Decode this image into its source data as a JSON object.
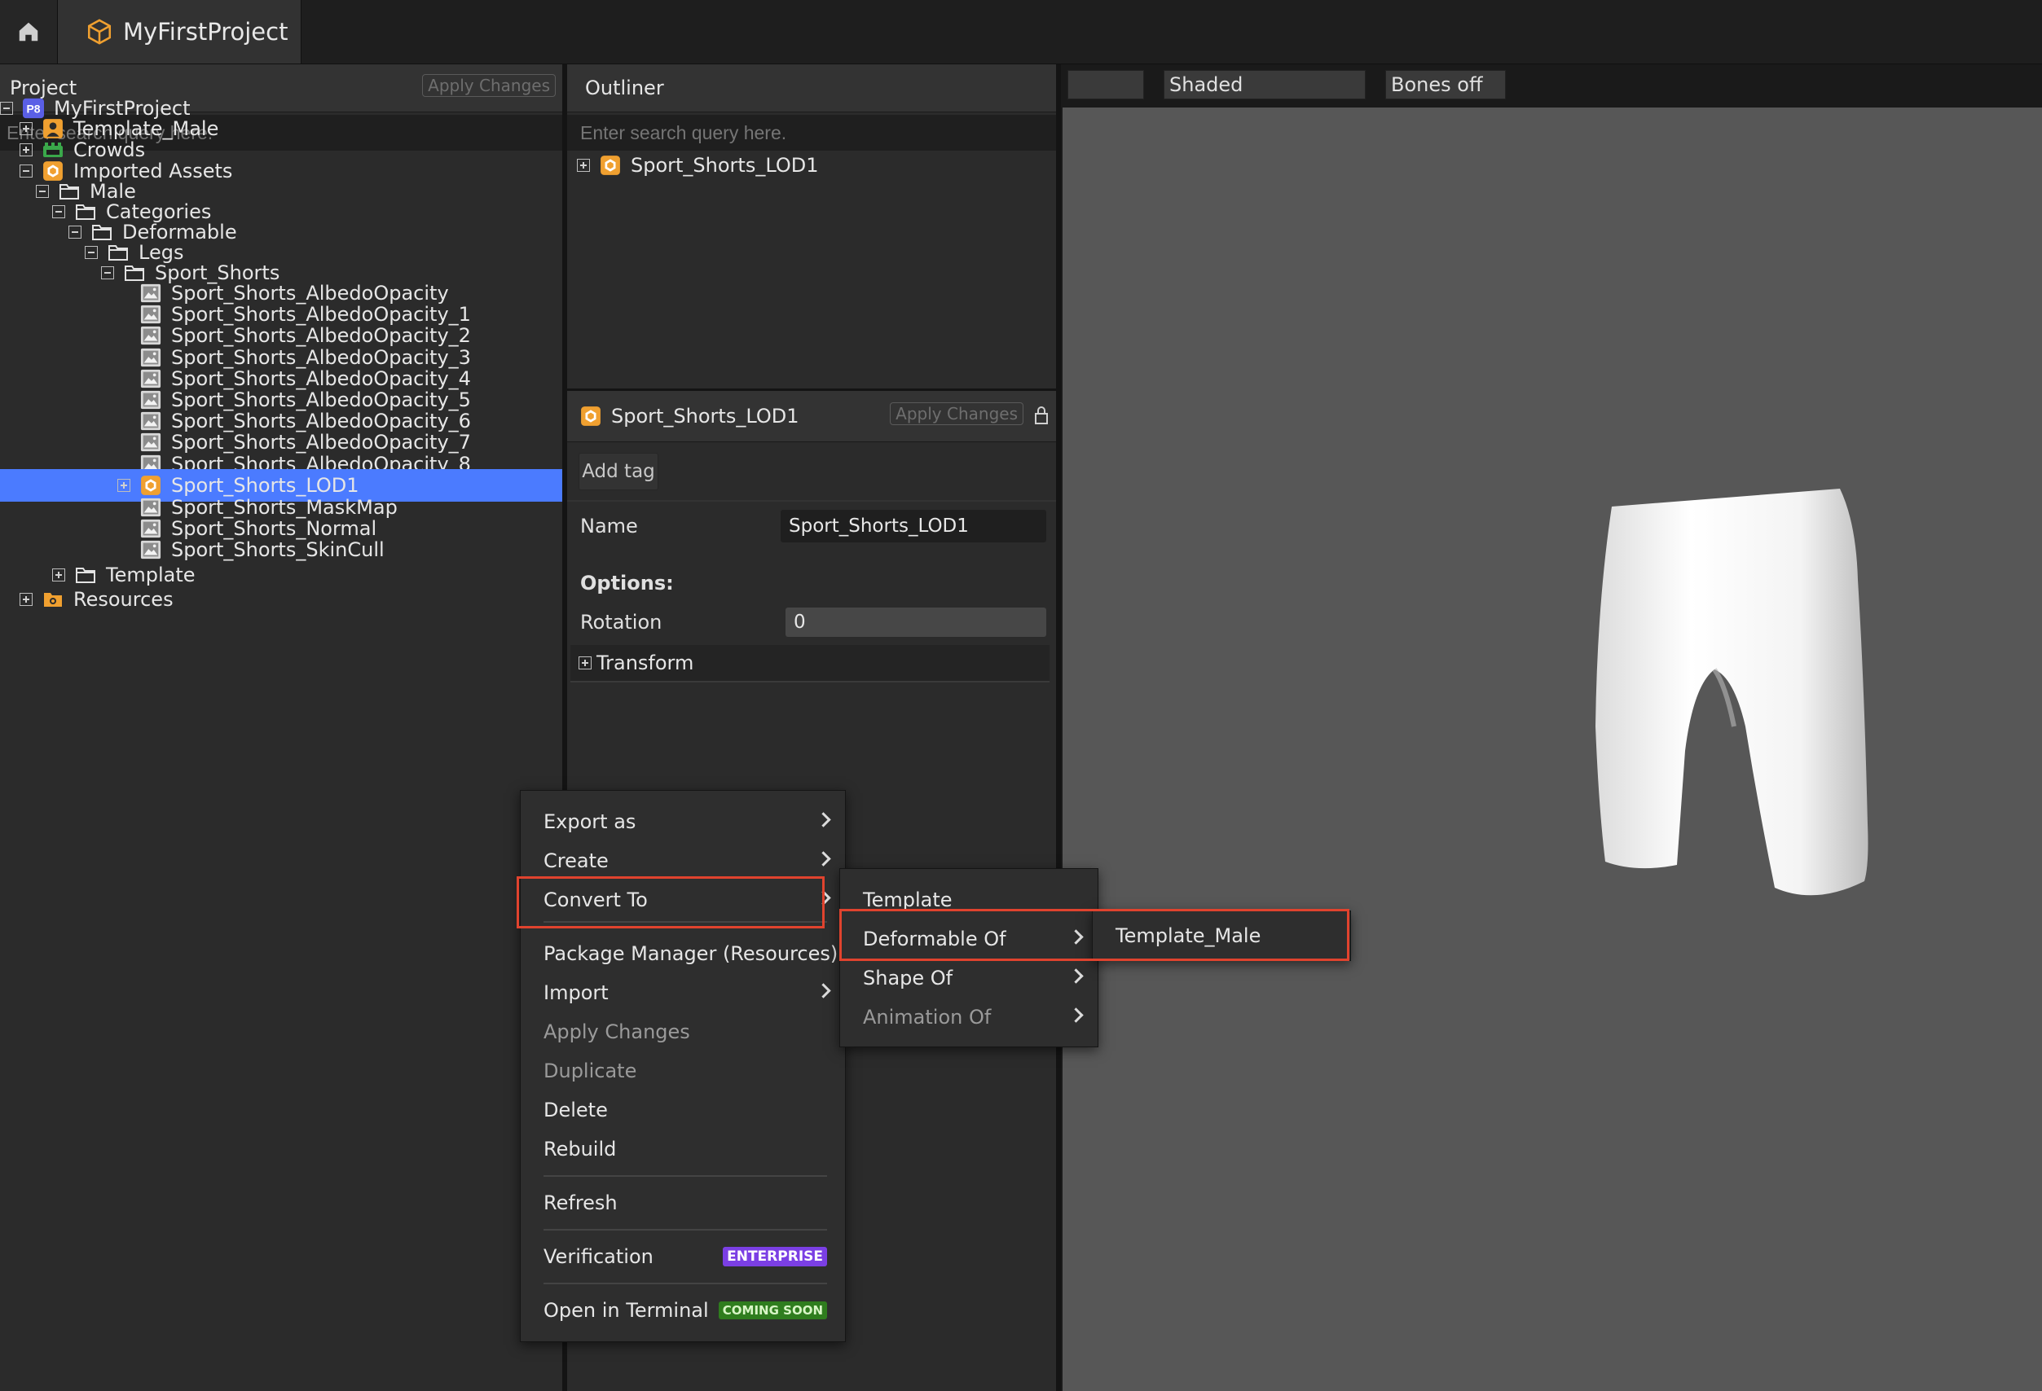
{
  "header": {
    "project_tab": "MyFirstProject"
  },
  "project_panel": {
    "title": "Project",
    "apply_changes": "Apply Changes",
    "search_placeholder": "Enter search query here.",
    "tree": [
      {
        "label": "MyFirstProject",
        "icon": "p8-project-icon",
        "expander": "minus"
      },
      {
        "label": "Template_Male",
        "icon": "template-male-icon",
        "expander": "plus"
      },
      {
        "label": "Crowds",
        "icon": "crowds-icon",
        "expander": "plus"
      },
      {
        "label": "Imported Assets",
        "icon": "imported-assets-icon",
        "expander": "minus"
      },
      {
        "label": "Male",
        "icon": "folder-icon",
        "expander": "minus"
      },
      {
        "label": "Categories",
        "icon": "folder-icon",
        "expander": "minus"
      },
      {
        "label": "Deformable",
        "icon": "folder-icon",
        "expander": "minus"
      },
      {
        "label": "Legs",
        "icon": "folder-icon",
        "expander": "minus"
      },
      {
        "label": "Sport_Shorts",
        "icon": "folder-icon",
        "expander": "minus"
      },
      {
        "label": "Sport_Shorts_AlbedoOpacity",
        "icon": "image-icon",
        "expander": "none"
      },
      {
        "label": "Sport_Shorts_AlbedoOpacity_1",
        "icon": "image-icon",
        "expander": "none"
      },
      {
        "label": "Sport_Shorts_AlbedoOpacity_2",
        "icon": "image-icon",
        "expander": "none"
      },
      {
        "label": "Sport_Shorts_AlbedoOpacity_3",
        "icon": "image-icon",
        "expander": "none"
      },
      {
        "label": "Sport_Shorts_AlbedoOpacity_4",
        "icon": "image-icon",
        "expander": "none"
      },
      {
        "label": "Sport_Shorts_AlbedoOpacity_5",
        "icon": "image-icon",
        "expander": "none"
      },
      {
        "label": "Sport_Shorts_AlbedoOpacity_6",
        "icon": "image-icon",
        "expander": "none"
      },
      {
        "label": "Sport_Shorts_AlbedoOpacity_7",
        "icon": "image-icon",
        "expander": "none"
      },
      {
        "label": "Sport_Shorts_AlbedoOpacity_8",
        "icon": "image-icon",
        "expander": "none"
      },
      {
        "label": "Sport_Shorts_LOD1",
        "icon": "mesh-asset-icon",
        "expander": "plus",
        "selected": true
      },
      {
        "label": "Sport_Shorts_MaskMap",
        "icon": "image-icon",
        "expander": "none"
      },
      {
        "label": "Sport_Shorts_Normal",
        "icon": "image-icon",
        "expander": "none"
      },
      {
        "label": "Sport_Shorts_SkinCull",
        "icon": "image-icon",
        "expander": "none"
      },
      {
        "label": "Template",
        "icon": "folder-icon",
        "expander": "plus"
      },
      {
        "label": "Resources",
        "icon": "resources-icon",
        "expander": "plus"
      }
    ]
  },
  "outliner": {
    "title": "Outliner",
    "search_placeholder": "Enter search query here.",
    "items": [
      {
        "label": "Sport_Shorts_LOD1"
      }
    ]
  },
  "properties": {
    "asset_name": "Sport_Shorts_LOD1",
    "apply_changes": "Apply Changes",
    "add_tag": "Add tag",
    "name_label": "Name",
    "name_value": "Sport_Shorts_LOD1",
    "options_label": "Options:",
    "rotation_label": "Rotation",
    "rotation_value": "0",
    "transform_label": "Transform"
  },
  "viewport": {
    "shading_label": "Shaded",
    "bones_label": "Bones off"
  },
  "context_menu": {
    "items": [
      {
        "label": "Export as",
        "submenu": true
      },
      {
        "label": "Create",
        "submenu": true
      },
      {
        "label": "Convert To",
        "submenu": true
      },
      {
        "label": "Package Manager (Resources)"
      },
      {
        "label": "Import",
        "submenu": true
      },
      {
        "label": "Apply Changes",
        "disabled": true
      },
      {
        "label": "Duplicate",
        "disabled": true
      },
      {
        "label": "Delete"
      },
      {
        "label": "Rebuild"
      },
      {
        "label": "Refresh"
      },
      {
        "label": "Verification",
        "badge": "ENTERPRISE"
      },
      {
        "label": "Open in Terminal",
        "badge": "COMING SOON"
      }
    ]
  },
  "convert_submenu": {
    "items": [
      {
        "label": "Template"
      },
      {
        "label": "Deformable Of",
        "submenu": true
      },
      {
        "label": "Shape Of",
        "submenu": true
      },
      {
        "label": "Animation Of",
        "submenu": true,
        "disabled": true
      }
    ]
  },
  "deformable_submenu": {
    "items": [
      {
        "label": "Template_Male"
      }
    ]
  },
  "colors": {
    "selection": "#4b7bff",
    "highlight_box": "#e0432e",
    "enterprise_badge": "#7b3fe4",
    "coming_soon_badge": "#2f7d1e",
    "asset_orange": "#f0a030"
  }
}
